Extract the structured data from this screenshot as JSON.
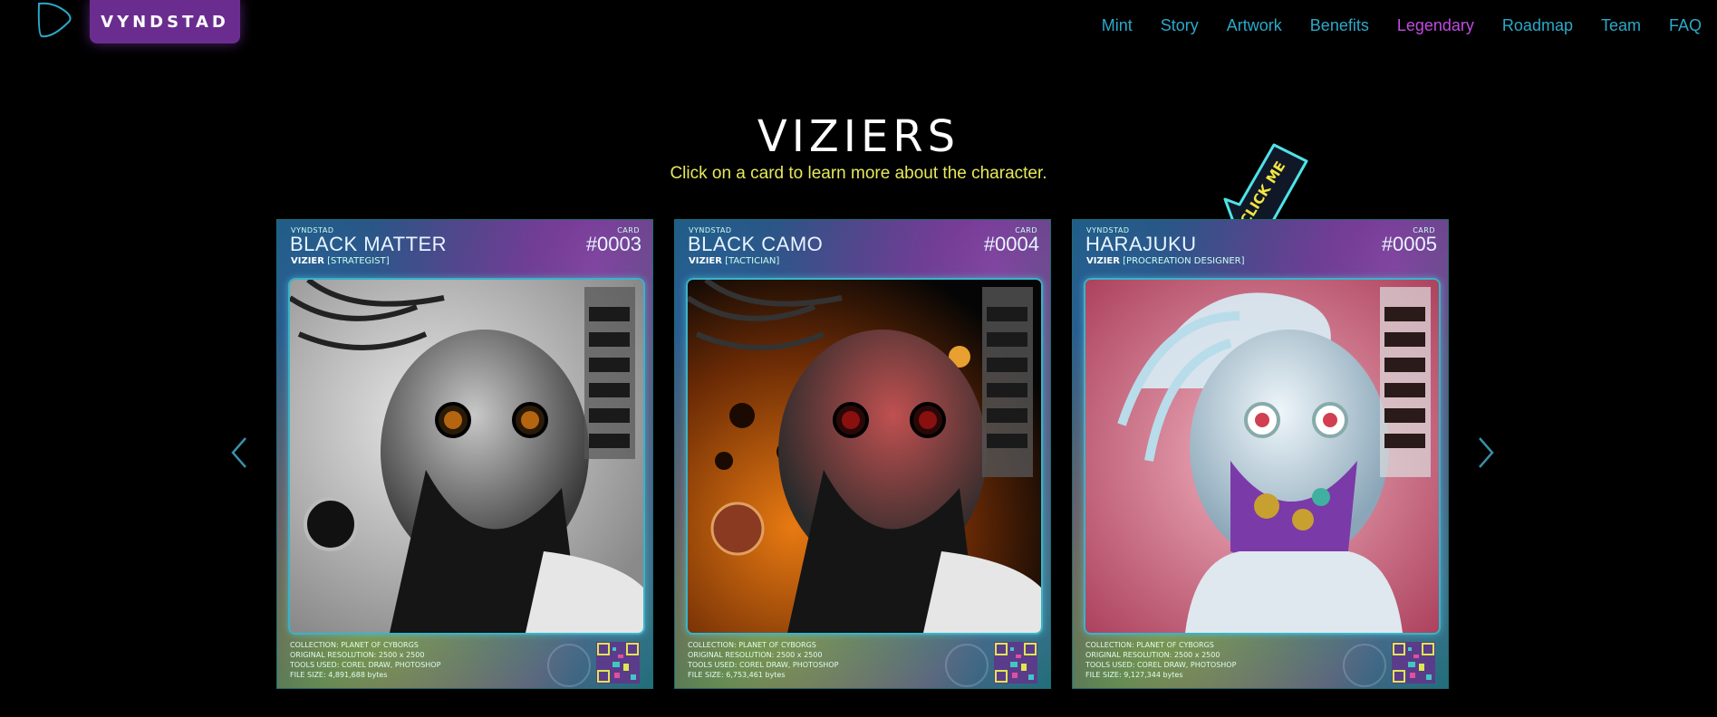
{
  "header": {
    "brand": "VYNDSTAD",
    "nav": [
      {
        "label": "Mint",
        "active": false
      },
      {
        "label": "Story",
        "active": false
      },
      {
        "label": "Artwork",
        "active": false
      },
      {
        "label": "Benefits",
        "active": false
      },
      {
        "label": "Legendary",
        "active": true
      },
      {
        "label": "Roadmap",
        "active": false
      },
      {
        "label": "Team",
        "active": false
      },
      {
        "label": "FAQ",
        "active": false
      }
    ]
  },
  "section": {
    "title": "VIZIERS",
    "subtitle": "Click on a card to learn more about the character."
  },
  "sticker": {
    "text": "CLICK ME"
  },
  "carousel": {
    "prev_icon": "chevron-left-icon",
    "next_icon": "chevron-right-icon",
    "cards": [
      {
        "brand": "VYNDSTAD",
        "card_label": "CARD",
        "name": "BLACK MATTER",
        "number": "#0003",
        "role_prefix": "VIZIER",
        "role": "[STRATEGIST]",
        "collection": "COLLECTION:  PLANET OF CYBORGS",
        "resolution": "ORIGINAL RESOLUTION:  2500 x 2500",
        "tools": "TOOLS USED:  COREL DRAW, PHOTOSHOP",
        "filesize": "FILE SIZE:  4,891,688 bytes"
      },
      {
        "brand": "VYNDSTAD",
        "card_label": "CARD",
        "name": "BLACK CAMO",
        "number": "#0004",
        "role_prefix": "VIZIER",
        "role": "[TACTICIAN]",
        "collection": "COLLECTION:  PLANET OF CYBORGS",
        "resolution": "ORIGINAL RESOLUTION:  2500 x 2500",
        "tools": "TOOLS USED:  COREL DRAW, PHOTOSHOP",
        "filesize": "FILE SIZE:  6,753,461 bytes"
      },
      {
        "brand": "VYNDSTAD",
        "card_label": "CARD",
        "name": "HARAJUKU",
        "number": "#0005",
        "role_prefix": "VIZIER",
        "role": "[PROCREATION DESIGNER]",
        "collection": "COLLECTION:  PLANET OF CYBORGS",
        "resolution": "ORIGINAL RESOLUTION:  2500 x 2500",
        "tools": "TOOLS USED:  COREL DRAW, PHOTOSHOP",
        "filesize": "FILE SIZE:  9,127,344 bytes"
      }
    ]
  },
  "colors": {
    "nav": "#2ba9c9",
    "nav_active": "#c24be0",
    "subtitle": "#e7e85a",
    "brand_bg": "#6a2d8f"
  }
}
